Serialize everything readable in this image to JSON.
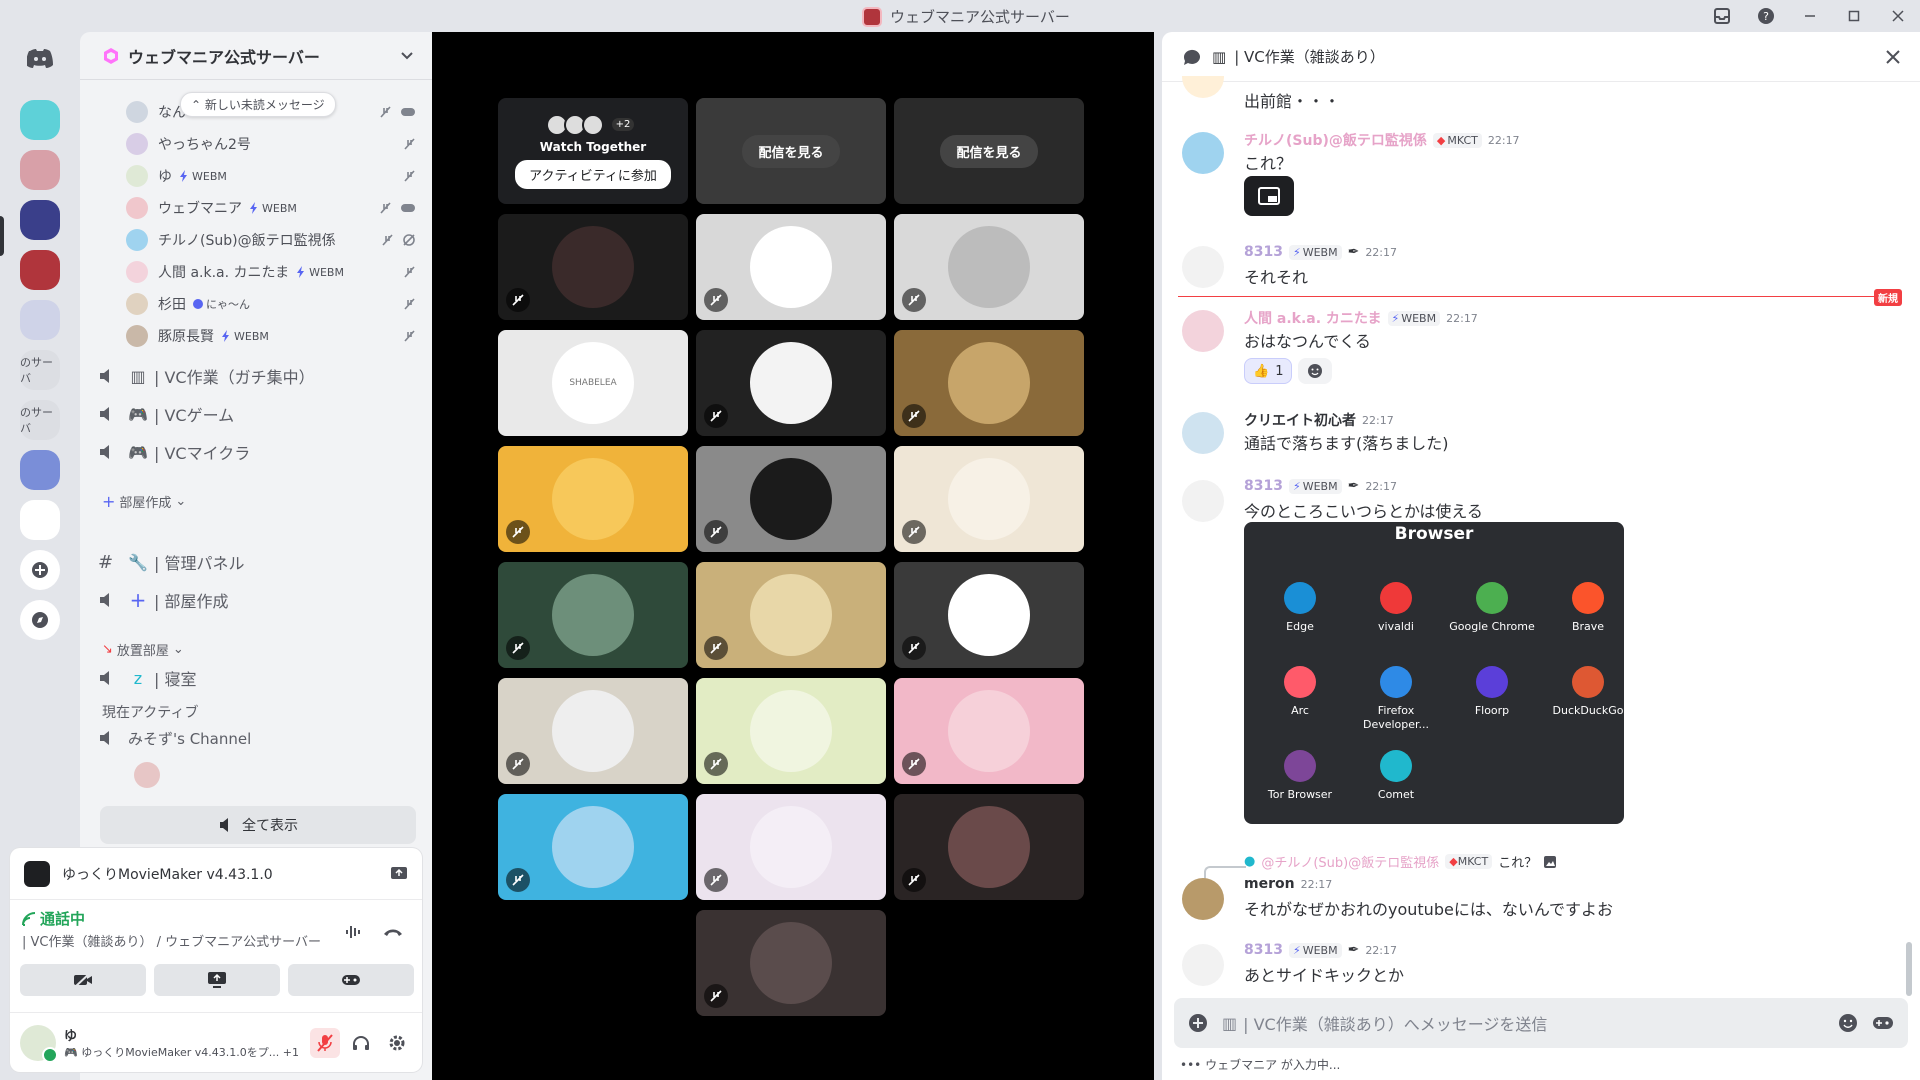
{
  "window": {
    "title": "ウェブマニア公式サーバー"
  },
  "server": {
    "name": "ウェブマニア公式サーバー"
  },
  "unread_pill": "新しい未読メッセージ",
  "members": [
    {
      "name": "なん",
      "tag": "",
      "color": "#cfd6e0"
    },
    {
      "name": "やっちゃん2号",
      "tag": "",
      "color": "#d8cde6"
    },
    {
      "name": "ゆ",
      "tag": "WEBM",
      "color": "#dfe9d6"
    },
    {
      "name": "ウェブマニア",
      "tag": "WEBM",
      "color": "#f0c7cc"
    },
    {
      "name": "チルノ(Sub)@飯テロ監視係",
      "tag": "",
      "color": "#9fd3ef"
    },
    {
      "name": "人間 a.k.a. カニたま",
      "tag": "WEBM",
      "color": "#f3d3dc"
    },
    {
      "name": "杉田",
      "tag": "にゃ〜ん",
      "color": "#e0d2c0"
    },
    {
      "name": "豚原長賢",
      "tag": "WEBM",
      "color": "#c9b8a8"
    }
  ],
  "voice_channels": [
    {
      "name": "| VC作業（ガチ集中）"
    },
    {
      "name": "| VCゲーム"
    },
    {
      "name": "| VCマイクラ"
    }
  ],
  "cat_room": "部屋作成",
  "text_admin": "| 管理パネル",
  "voice_create": "| 部屋作成",
  "cat_afk": "放置部屋",
  "voice_sleep": "| 寝室",
  "active_now": {
    "header": "現在アクティブ",
    "channel": "みそず's Channel"
  },
  "show_all": "全て表示",
  "activity_app": "ゆっくりMovieMaker v4.43.1.0",
  "voice_status": {
    "connected": "通話中",
    "location": "| VC作業（雑談あり） / ウェブマニア公式サーバー"
  },
  "user": {
    "name": "ゆ",
    "status": "ゆっくりMovieMaker v4.43.1.0をプ...",
    "extra": "+1"
  },
  "stage": {
    "watch_together": "Watch Together",
    "join_activity": "アクティビティに参加",
    "watch_stream": "配信を見る",
    "plus": "+2",
    "tiles": [
      {
        "bg": "#1b1b1b",
        "avatar": "#3a2a2a",
        "muted": true
      },
      {
        "bg": "#d8d8d8",
        "avatar": "#ffffff",
        "muted": true
      },
      {
        "bg": "#d9d9d9",
        "avatar": "#bcbcbc",
        "muted": true
      },
      {
        "bg": "#e9e9e9",
        "avatar": "#ffffff",
        "muted": false,
        "label": "SHABELEA"
      },
      {
        "bg": "#222222",
        "avatar": "#f3f3f3",
        "muted": true
      },
      {
        "bg": "#8a6a3a",
        "avatar": "#c7a56a",
        "muted": true
      },
      {
        "bg": "#f0b33a",
        "avatar": "#f7c85a",
        "muted": true
      },
      {
        "bg": "#8a8a8a",
        "avatar": "#1b1b1b",
        "muted": true
      },
      {
        "bg": "#efe6d6",
        "avatar": "#f7f1e6",
        "muted": true
      },
      {
        "bg": "#2f4a3a",
        "avatar": "#6d8f7a",
        "muted": true
      },
      {
        "bg": "#c9b07a",
        "avatar": "#e8d7a8",
        "muted": true
      },
      {
        "bg": "#3a3a3a",
        "avatar": "#ffffff",
        "muted": true
      },
      {
        "bg": "#d8d3c8",
        "avatar": "#eeeeee",
        "muted": true
      },
      {
        "bg": "#e2ecc4",
        "avatar": "#f0f5e0",
        "muted": true
      },
      {
        "bg": "#f2b8c8",
        "avatar": "#f6d0d9",
        "muted": true
      },
      {
        "bg": "#3fb3e0",
        "avatar": "#9fd3ef",
        "muted": true
      },
      {
        "bg": "#ece3ee",
        "avatar": "#f4eef6",
        "muted": true
      },
      {
        "bg": "#2a2424",
        "avatar": "#6a4a4a",
        "muted": true
      },
      {
        "bg": "#3a3232",
        "avatar": "#5a4c4c",
        "muted": true
      }
    ]
  },
  "chat": {
    "channel": "| VC作業（雑談あり）",
    "new_label": "新規",
    "messages": [
      {
        "author": "",
        "text": "出前館・・・",
        "time": "",
        "badge": "",
        "color": "#fff0d8"
      },
      {
        "author": "チルノ(Sub)@飯テロ監視係",
        "text": "これ？",
        "time": "22:17",
        "badge": "MKCT",
        "color": "#9fd3ef"
      },
      {
        "author": "8313",
        "text": "それそれ",
        "time": "22:17",
        "badge": "WEBM",
        "color": "#f2f2f2"
      },
      {
        "author": "人間 a.k.a. カニたま",
        "text": "おはなつんでくる",
        "time": "22:17",
        "badge": "WEBM",
        "color": "#f3d3dc"
      },
      {
        "author": "クリエイト初心者",
        "text": "通話で落ちます(落ちました)",
        "time": "22:17",
        "badge": "",
        "color": "#cfe3f0"
      },
      {
        "author": "8313",
        "text": "今のところこいつらとかは使える",
        "time": "22:17",
        "badge": "WEBM",
        "color": "#f2f2f2"
      },
      {
        "author": "meron",
        "text": "それがなぜかおれのyoutubeには、ないんですよお",
        "time": "22:17",
        "badge": "",
        "color": "#b89a6a"
      },
      {
        "author": "8313",
        "text": "あとサイドキックとか",
        "time": "22:17",
        "badge": "WEBM",
        "color": "#f2f2f2"
      }
    ],
    "reaction_count": "1",
    "reply": {
      "author": "@チルノ(Sub)@飯テロ監視係",
      "badge": "MKCT",
      "text": "これ？"
    },
    "embed": {
      "title": "Browser",
      "items": [
        {
          "name": "Edge",
          "color": "#1a8fd6"
        },
        {
          "name": "vivaldi",
          "color": "#ef3939"
        },
        {
          "name": "Google Chrome",
          "color": "#4caf50"
        },
        {
          "name": "Brave",
          "color": "#fb542b"
        },
        {
          "name": "Arc",
          "color": "#ff5a6a"
        },
        {
          "name": "Firefox Developer...",
          "color": "#2e8ae6"
        },
        {
          "name": "Floorp",
          "color": "#5b3fd9"
        },
        {
          "name": "DuckDuckGo",
          "color": "#de5833"
        },
        {
          "name": "Tor Browser",
          "color": "#7d4698"
        },
        {
          "name": "Comet",
          "color": "#20b8cd"
        }
      ]
    },
    "composer_placeholder": "| VC作業（雑談あり）へメッセージを送信",
    "typing": "ウェブマニア が入力中..."
  }
}
